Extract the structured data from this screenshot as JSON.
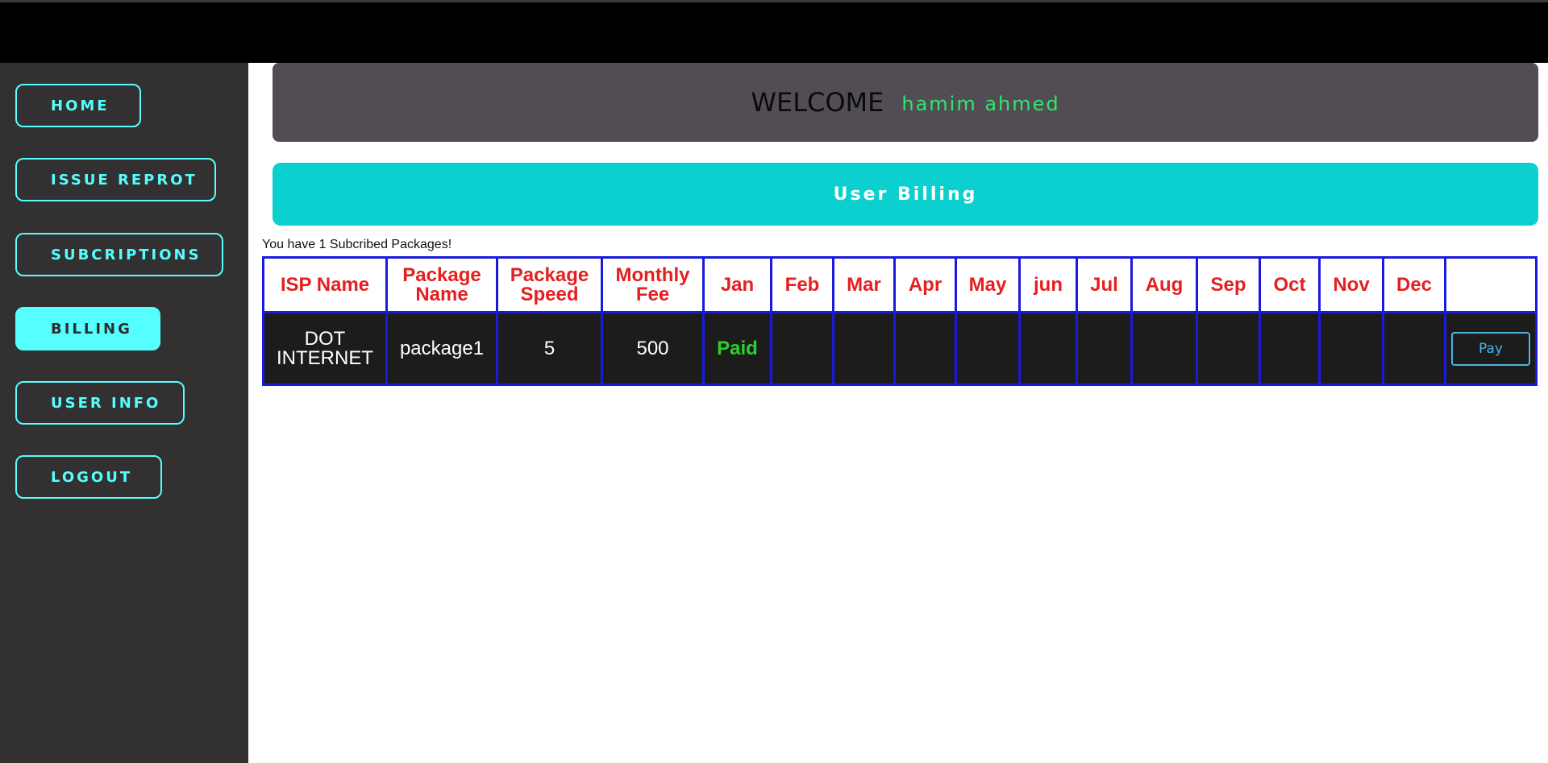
{
  "sidebar": {
    "items": [
      {
        "label": "HOME"
      },
      {
        "label": "ISSUE REPROT"
      },
      {
        "label": "SUBCRIPTIONS"
      },
      {
        "label": "BILLING"
      },
      {
        "label": "USER INFO"
      },
      {
        "label": "LOGOUT"
      }
    ]
  },
  "header": {
    "welcome": "WELCOME",
    "user_name": "hamim ahmed"
  },
  "billing": {
    "title": "User Billing",
    "subscribed_text": "You have 1 Subcribed Packages!",
    "columns": [
      "ISP Name",
      "Package Name",
      "Package Speed",
      "Monthly Fee",
      "Jan",
      "Feb",
      "Mar",
      "Apr",
      "May",
      "jun",
      "Jul",
      "Aug",
      "Sep",
      "Oct",
      "Nov",
      "Dec",
      ""
    ],
    "rows": [
      {
        "isp_name": "DOT INTERNET",
        "package_name": "package1",
        "package_speed": "5",
        "monthly_fee": "500",
        "months": [
          "Paid",
          "",
          "",
          "",
          "",
          "",
          "",
          "",
          "",
          "",
          "",
          ""
        ],
        "pay_label": "Pay"
      }
    ]
  },
  "colors": {
    "accent": "#55ffff",
    "banner": "#0ccfcf",
    "header_bg": "#524d55",
    "table_border": "#1a1adf",
    "header_text": "#e51f1f",
    "paid": "#2dcf2d"
  }
}
